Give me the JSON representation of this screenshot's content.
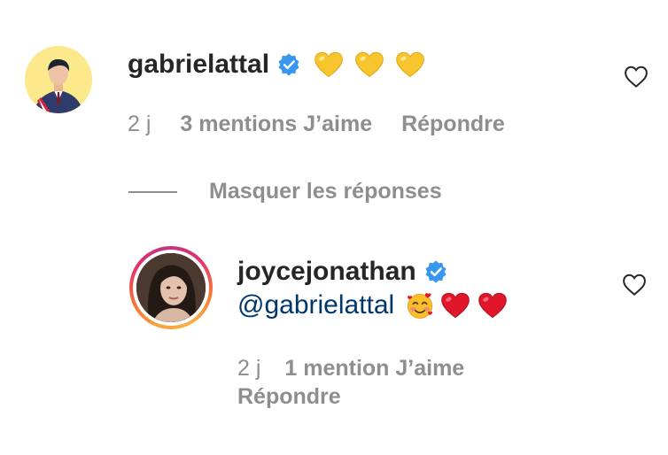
{
  "comment": {
    "username": "gabrielattal",
    "time": "2 j",
    "likes": "3 mentions J’aime",
    "reply": "Répondre",
    "emojis": [
      "yellow-heart",
      "yellow-heart",
      "yellow-heart"
    ]
  },
  "replies_toggle": "Masquer les réponses",
  "reply_comment": {
    "username": "joycejonathan",
    "mention": "@gabrielattal",
    "emojis": [
      "smiling-face-with-hearts",
      "red-heart",
      "red-heart"
    ],
    "time": "2 j",
    "likes": "1 mention J’aime",
    "reply": "Répondre"
  },
  "colors": {
    "text": "#262626",
    "secondary": "#8e8e8e",
    "mention_link": "#00376b",
    "verified_blue": "#3897f0",
    "yellow_heart": "#f7c62f",
    "red_heart": "#e0162b"
  }
}
